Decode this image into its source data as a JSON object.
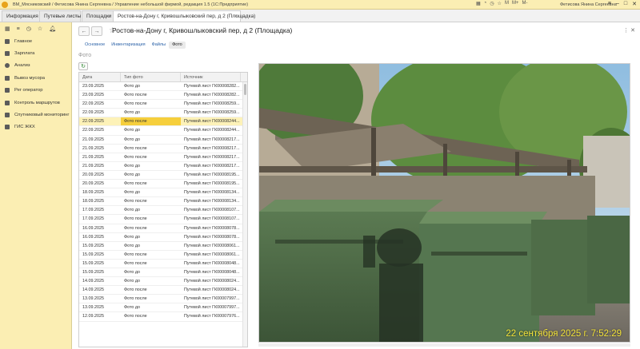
{
  "window": {
    "title": "ВМ_Мясниковский / Фетисова Янина Сергеевна / Управление небольшой фирмой, редакция 1.5 (1С:Предприятие)",
    "user": "Фетисова Янина Сергеевна"
  },
  "tabs": [
    {
      "label": "Информация"
    },
    {
      "label": "Путевые листы"
    },
    {
      "label": "Площадки"
    },
    {
      "label": "Ростов-на-Дону г, Кривошлыковский пер, д 2 (Площадка)"
    }
  ],
  "sidebar": {
    "items": [
      {
        "label": "Главное"
      },
      {
        "label": "Зарплата"
      },
      {
        "label": "Анализ"
      },
      {
        "label": "Вывоз мусора"
      },
      {
        "label": "Рег оператор"
      },
      {
        "label": "Контроль маршрутов"
      },
      {
        "label": "Спутниковый мониторинг"
      },
      {
        "label": "ГИС ЖКХ"
      }
    ]
  },
  "page": {
    "title": "Ростов-на-Дону г, Кривошлыковский пер, д 2 (Площадка)",
    "subtabs": [
      "Основное",
      "Инвентаризация",
      "Файлы",
      "Фото"
    ],
    "active_subtab": "Фото",
    "section": "Фото"
  },
  "table": {
    "headers": [
      "Дата",
      "Тип фото",
      "Источник"
    ],
    "rows": [
      {
        "date": "23.09.2025",
        "type": "Фото до",
        "source": "Путевой лист ГК00008282..."
      },
      {
        "date": "23.09.2025",
        "type": "Фото после",
        "source": "Путевой лист ГК00008282..."
      },
      {
        "date": "22.09.2025",
        "type": "Фото после",
        "source": "Путевой лист ГК00008259..."
      },
      {
        "date": "22.09.2025",
        "type": "Фото до",
        "source": "Путевой лист ГК00008259..."
      },
      {
        "date": "22.09.2025",
        "type": "Фото после",
        "source": "Путевой лист ГК00008244...",
        "selected": true
      },
      {
        "date": "22.09.2025",
        "type": "Фото до",
        "source": "Путевой лист ГК00008244..."
      },
      {
        "date": "21.09.2025",
        "type": "Фото до",
        "source": "Путевой лист ГК00008217..."
      },
      {
        "date": "21.09.2025",
        "type": "Фото после",
        "source": "Путевой лист ГК00008217..."
      },
      {
        "date": "21.09.2025",
        "type": "Фото после",
        "source": "Путевой лист ГК00008217..."
      },
      {
        "date": "21.09.2025",
        "type": "Фото до",
        "source": "Путевой лист ГК00008217..."
      },
      {
        "date": "20.09.2025",
        "type": "Фото до",
        "source": "Путевой лист ГК00008195..."
      },
      {
        "date": "20.09.2025",
        "type": "Фото после",
        "source": "Путевой лист ГК00008195..."
      },
      {
        "date": "18.09.2025",
        "type": "Фото до",
        "source": "Путевой лист ГК00008134..."
      },
      {
        "date": "18.09.2025",
        "type": "Фото после",
        "source": "Путевой лист ГК00008134..."
      },
      {
        "date": "17.09.2025",
        "type": "Фото до",
        "source": "Путевой лист ГК00008107..."
      },
      {
        "date": "17.09.2025",
        "type": "Фото после",
        "source": "Путевой лист ГК00008107..."
      },
      {
        "date": "16.09.2025",
        "type": "Фото после",
        "source": "Путевой лист ГК00008078..."
      },
      {
        "date": "16.09.2025",
        "type": "Фото до",
        "source": "Путевой лист ГК00008078..."
      },
      {
        "date": "15.09.2025",
        "type": "Фото до",
        "source": "Путевой лист ГК00008061..."
      },
      {
        "date": "15.09.2025",
        "type": "Фото после",
        "source": "Путевой лист ГК00008061..."
      },
      {
        "date": "15.09.2025",
        "type": "Фото после",
        "source": "Путевой лист ГК00008048..."
      },
      {
        "date": "15.09.2025",
        "type": "Фото до",
        "source": "Путевой лист ГК00008048..."
      },
      {
        "date": "14.09.2025",
        "type": "Фото до",
        "source": "Путевой лист ГК00008024..."
      },
      {
        "date": "14.09.2025",
        "type": "Фото после",
        "source": "Путевой лист ГК00008024..."
      },
      {
        "date": "13.09.2025",
        "type": "Фото после",
        "source": "Путевой лист ГК00007997..."
      },
      {
        "date": "13.09.2025",
        "type": "Фото до",
        "source": "Путевой лист ГК00007997..."
      },
      {
        "date": "12.09.2025",
        "type": "Фото после",
        "source": "Путевой лист ГК00007976..."
      }
    ]
  },
  "photo": {
    "timestamp": "22 сентября 2025 г. 7:52:29"
  },
  "colors": {
    "sidebar_bg": "#fbeeb3",
    "selected_row": "#fdf2b8",
    "selected_cell": "#f6cf3c",
    "link": "#2b62a8",
    "timestamp": "#f2e23a"
  }
}
